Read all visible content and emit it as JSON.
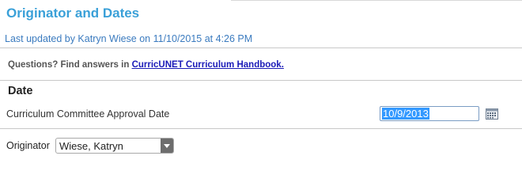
{
  "header": {
    "title": "Originator and Dates",
    "last_updated": "Last updated by Katryn Wiese on 11/10/2015 at 4:26 PM"
  },
  "help": {
    "prefix": "Questions? Find answers in ",
    "link_text": "CurricUNET Curriculum Handbook."
  },
  "date_section": {
    "heading": "Date",
    "approval_label": "Curriculum Committee Approval Date",
    "approval_value": "10/9/2013",
    "calendar_icon": "calendar-icon"
  },
  "originator": {
    "label": "Originator",
    "selected": "Wiese, Katryn",
    "dropdown_icon": "chevron-down-icon"
  },
  "colors": {
    "title": "#3aa0d8",
    "last_updated": "#3b7bbf",
    "link": "#1b1bb8",
    "selection": "#3399ff"
  }
}
